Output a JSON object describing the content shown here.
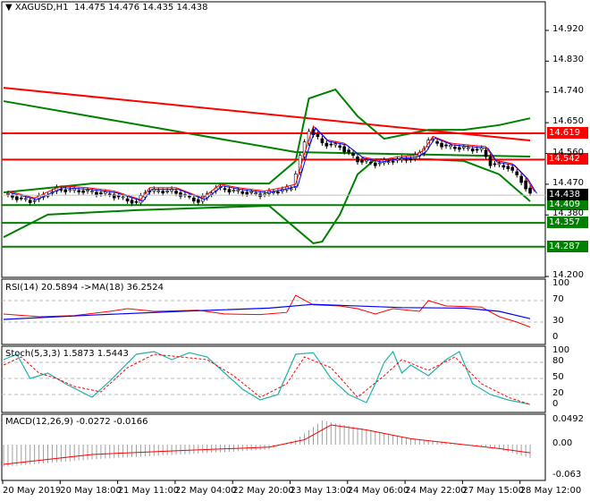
{
  "header": {
    "symbol": "XAGUSD,H1",
    "ohlc": "14.475 14.476 14.435 14.438"
  },
  "price_axis": [
    "14.920",
    "14.830",
    "14.740",
    "14.650",
    "14.560",
    "14.470",
    "14.380",
    "14.200"
  ],
  "levels": [
    {
      "value": "14.619",
      "color": "#ff0000"
    },
    {
      "value": "14.542",
      "color": "#ff0000"
    },
    {
      "value": "14.409",
      "color": "#008000"
    },
    {
      "value": "14.357",
      "color": "#008000"
    },
    {
      "value": "14.287",
      "color": "#008000"
    }
  ],
  "current_price": "14.438",
  "rsi": {
    "label": "RSI(14) 20.5894  ->MA(18) 36.2524",
    "axis": [
      "100",
      "70",
      "30",
      "0"
    ]
  },
  "stoch": {
    "label": "Stoch(5,3,3) 1.5873 1.5443",
    "axis": [
      "100",
      "80",
      "50",
      "20",
      "0"
    ]
  },
  "macd": {
    "label": "MACD(12,26,9) -0.0272 -0.0166",
    "axis": [
      "0.0492",
      "0.00",
      "-0.063"
    ]
  },
  "time_axis": [
    "20 May 2019",
    "20 May 18:00",
    "21 May 11:00",
    "22 May 04:00",
    "22 May 20:00",
    "23 May 13:00",
    "24 May 06:00",
    "24 May 22:00",
    "27 May 15:00",
    "28 May 12:00"
  ],
  "chart_data": {
    "type": "line",
    "price": [
      [
        0,
        14.44
      ],
      [
        6,
        14.42
      ],
      [
        12,
        14.455
      ],
      [
        18,
        14.45
      ],
      [
        24,
        14.44
      ],
      [
        30,
        14.415
      ],
      [
        32,
        14.45
      ],
      [
        38,
        14.45
      ],
      [
        44,
        14.42
      ],
      [
        48,
        14.46
      ],
      [
        52,
        14.45
      ],
      [
        58,
        14.44
      ],
      [
        62,
        14.45
      ],
      [
        65,
        14.46
      ],
      [
        67,
        14.55
      ],
      [
        69,
        14.63
      ],
      [
        72,
        14.59
      ],
      [
        76,
        14.58
      ],
      [
        80,
        14.54
      ],
      [
        84,
        14.53
      ],
      [
        88,
        14.54
      ],
      [
        92,
        14.545
      ],
      [
        94,
        14.56
      ],
      [
        96,
        14.6
      ],
      [
        100,
        14.58
      ],
      [
        104,
        14.575
      ],
      [
        108,
        14.57
      ],
      [
        110,
        14.53
      ],
      [
        114,
        14.52
      ],
      [
        117,
        14.48
      ],
      [
        119,
        14.438
      ]
    ],
    "bb_upper": [
      [
        0,
        14.446
      ],
      [
        20,
        14.472
      ],
      [
        60,
        14.472
      ],
      [
        66,
        14.538
      ],
      [
        69,
        14.721
      ],
      [
        75,
        14.747
      ],
      [
        80,
        14.669
      ],
      [
        86,
        14.603
      ],
      [
        96,
        14.629
      ],
      [
        104,
        14.629
      ],
      [
        112,
        14.643
      ],
      [
        119,
        14.663
      ]
    ],
    "bb_lower": [
      [
        0,
        14.315
      ],
      [
        10,
        14.381
      ],
      [
        30,
        14.394
      ],
      [
        60,
        14.407
      ],
      [
        66,
        14.341
      ],
      [
        70,
        14.297
      ],
      [
        72,
        14.302
      ],
      [
        76,
        14.381
      ],
      [
        80,
        14.499
      ],
      [
        84,
        14.543
      ],
      [
        96,
        14.543
      ],
      [
        104,
        14.538
      ],
      [
        112,
        14.499
      ],
      [
        119,
        14.42
      ]
    ],
    "ma_green": [
      [
        0,
        14.713
      ],
      [
        66,
        14.564
      ],
      [
        119,
        14.551
      ]
    ],
    "ma_red": [
      [
        0,
        14.752
      ],
      [
        119,
        14.598
      ]
    ],
    "rsi": [
      [
        0,
        45
      ],
      [
        8,
        40
      ],
      [
        16,
        42
      ],
      [
        24,
        50
      ],
      [
        28,
        55
      ],
      [
        34,
        50
      ],
      [
        44,
        52
      ],
      [
        50,
        45
      ],
      [
        58,
        44
      ],
      [
        64,
        48
      ],
      [
        66,
        80
      ],
      [
        70,
        62
      ],
      [
        76,
        60
      ],
      [
        80,
        55
      ],
      [
        84,
        45
      ],
      [
        88,
        55
      ],
      [
        94,
        50
      ],
      [
        96,
        70
      ],
      [
        100,
        60
      ],
      [
        108,
        58
      ],
      [
        112,
        40
      ],
      [
        116,
        30
      ],
      [
        119,
        20.6
      ]
    ],
    "rsi_ma": [
      [
        0,
        35
      ],
      [
        20,
        43
      ],
      [
        40,
        50
      ],
      [
        60,
        56
      ],
      [
        70,
        63
      ],
      [
        90,
        57
      ],
      [
        104,
        56
      ],
      [
        112,
        50
      ],
      [
        119,
        36.3
      ]
    ],
    "stoch_k": [
      [
        0,
        85
      ],
      [
        3,
        95
      ],
      [
        6,
        50
      ],
      [
        10,
        60
      ],
      [
        14,
        40
      ],
      [
        20,
        15
      ],
      [
        24,
        45
      ],
      [
        30,
        95
      ],
      [
        34,
        100
      ],
      [
        38,
        85
      ],
      [
        42,
        98
      ],
      [
        46,
        90
      ],
      [
        50,
        60
      ],
      [
        54,
        30
      ],
      [
        58,
        10
      ],
      [
        62,
        20
      ],
      [
        66,
        95
      ],
      [
        70,
        98
      ],
      [
        74,
        50
      ],
      [
        78,
        20
      ],
      [
        82,
        5
      ],
      [
        84,
        40
      ],
      [
        86,
        80
      ],
      [
        88,
        100
      ],
      [
        90,
        60
      ],
      [
        92,
        75
      ],
      [
        96,
        55
      ],
      [
        100,
        85
      ],
      [
        103,
        100
      ],
      [
        106,
        40
      ],
      [
        110,
        20
      ],
      [
        114,
        10
      ],
      [
        119,
        1.6
      ]
    ],
    "stoch_d": [
      [
        0,
        75
      ],
      [
        4,
        90
      ],
      [
        8,
        60
      ],
      [
        12,
        50
      ],
      [
        16,
        35
      ],
      [
        22,
        25
      ],
      [
        28,
        70
      ],
      [
        34,
        95
      ],
      [
        40,
        90
      ],
      [
        46,
        85
      ],
      [
        52,
        55
      ],
      [
        58,
        15
      ],
      [
        64,
        40
      ],
      [
        68,
        90
      ],
      [
        74,
        70
      ],
      [
        80,
        15
      ],
      [
        86,
        55
      ],
      [
        90,
        85
      ],
      [
        96,
        65
      ],
      [
        102,
        90
      ],
      [
        108,
        40
      ],
      [
        114,
        15
      ],
      [
        119,
        1.5
      ]
    ],
    "macd_hist": [
      [
        0,
        -0.045
      ],
      [
        20,
        -0.03
      ],
      [
        40,
        -0.02
      ],
      [
        60,
        -0.01
      ],
      [
        66,
        0.01
      ],
      [
        72,
        0.0492
      ],
      [
        80,
        0.035
      ],
      [
        90,
        0.015
      ],
      [
        100,
        0.005
      ],
      [
        110,
        -0.005
      ],
      [
        119,
        -0.0272
      ]
    ],
    "macd_signal": [
      [
        0,
        -0.04
      ],
      [
        20,
        -0.02
      ],
      [
        40,
        -0.012
      ],
      [
        60,
        -0.005
      ],
      [
        68,
        0.01
      ],
      [
        74,
        0.04
      ],
      [
        82,
        0.03
      ],
      [
        92,
        0.012
      ],
      [
        104,
        0.0
      ],
      [
        112,
        -0.008
      ],
      [
        119,
        -0.0166
      ]
    ]
  }
}
